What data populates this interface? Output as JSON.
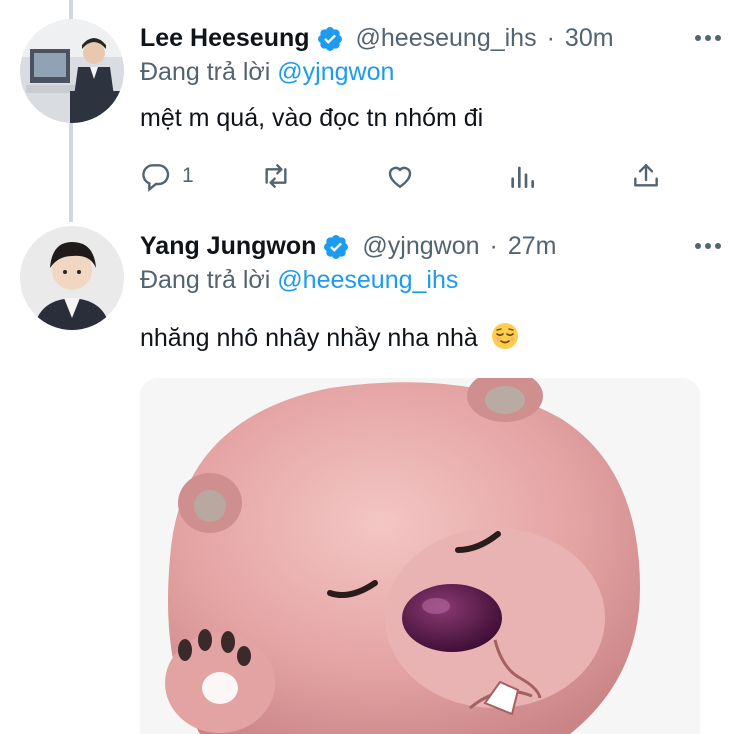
{
  "tweets": [
    {
      "name": "Lee Heeseung",
      "handle": "@heeseung_ihs",
      "separator": "·",
      "time": "30m",
      "reply_prefix": "Đang trả lời",
      "reply_to": "@yjngwon",
      "text": "mệt m quá, vào đọc tn nhóm đi",
      "reply_count": "1"
    },
    {
      "name": "Yang Jungwon",
      "handle": "@yjngwon",
      "separator": "·",
      "time": "27m",
      "reply_prefix": "Đang trả lời",
      "reply_to": "@heeseung_ihs",
      "text": "nhăng nhô nhây nhầy nha nhà",
      "emoji": "relieved-face"
    }
  ],
  "colors": {
    "link": "#1d9bf0",
    "secondary": "#536471",
    "verified": "#1d9bf0",
    "thread_line": "#cfd9de"
  },
  "icons": [
    "reply-icon",
    "retweet-icon",
    "like-icon",
    "analytics-icon",
    "share-icon",
    "more-icon",
    "verified-badge-icon"
  ]
}
